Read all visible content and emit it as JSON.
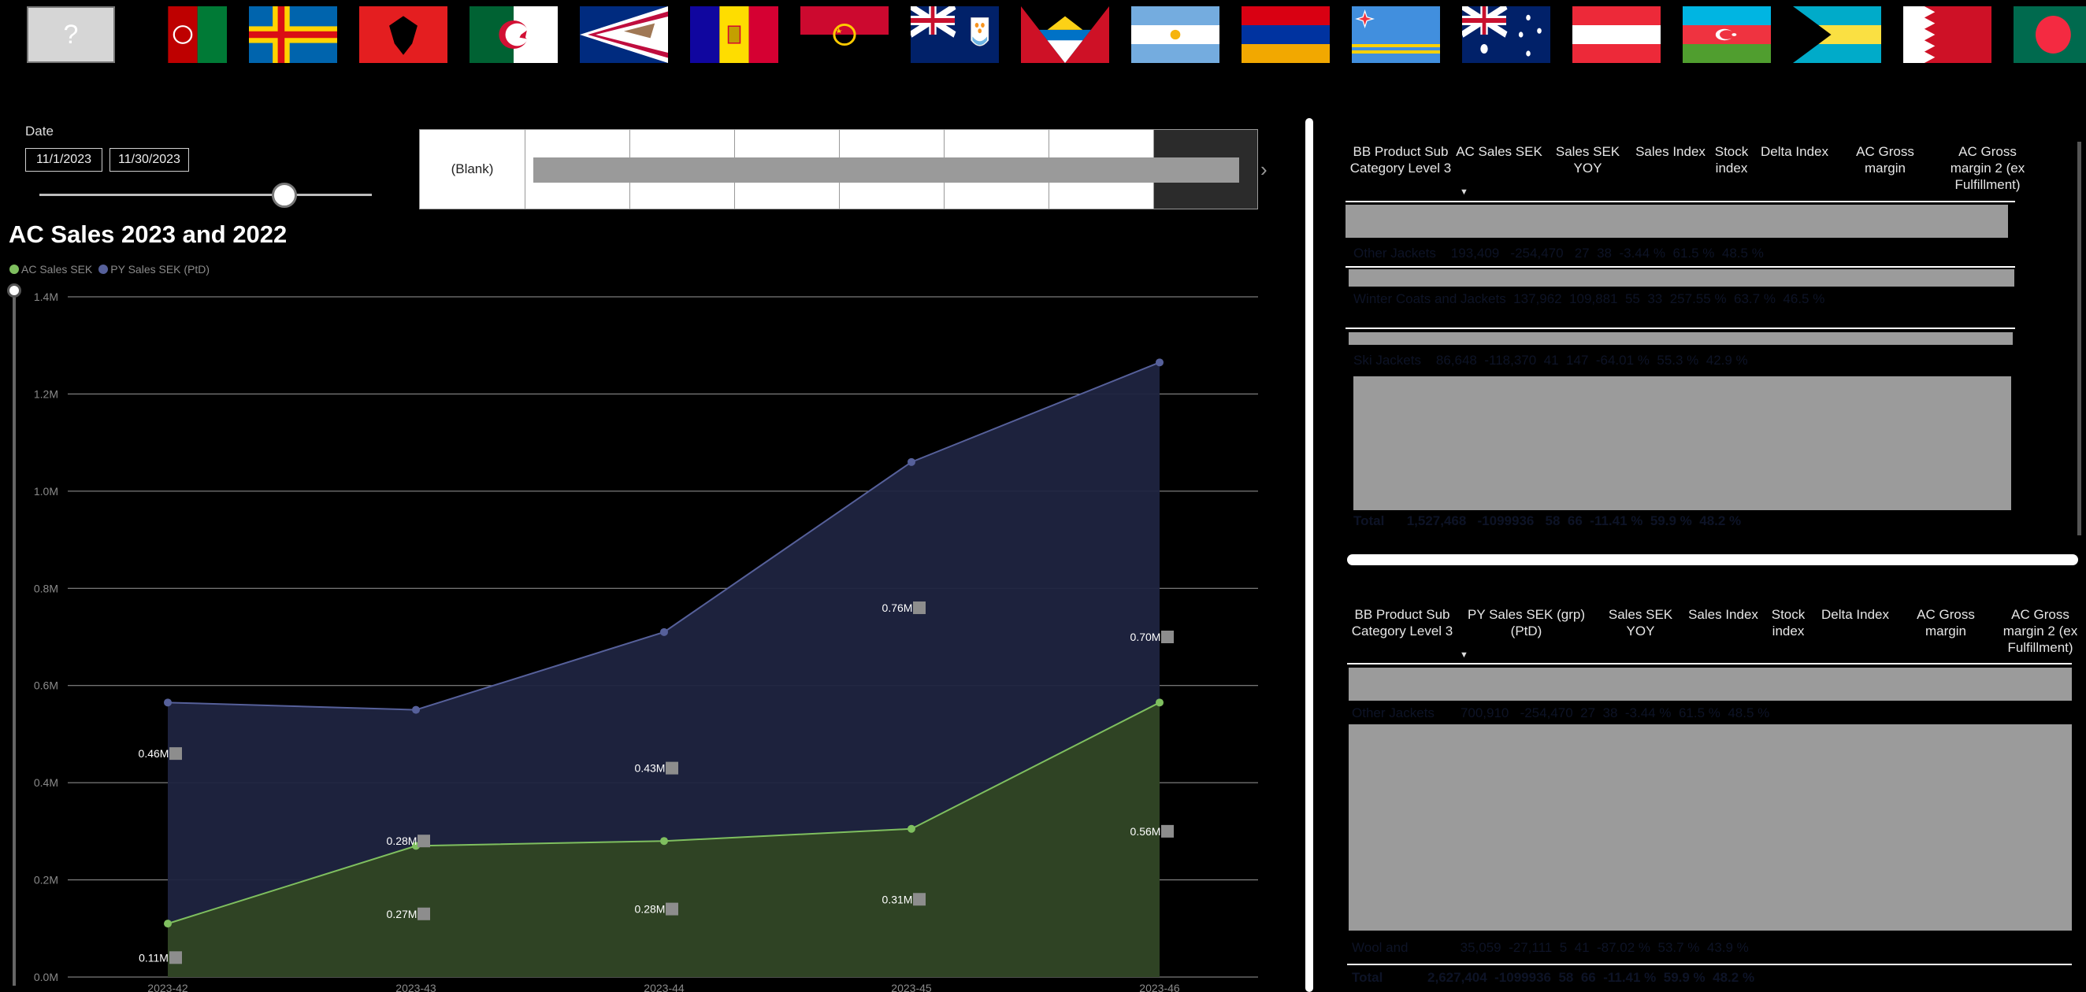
{
  "flags": [
    {
      "name": "unknown",
      "label": "?"
    },
    {
      "name": "afghanistan"
    },
    {
      "name": "aland"
    },
    {
      "name": "albania"
    },
    {
      "name": "algeria"
    },
    {
      "name": "american-samoa"
    },
    {
      "name": "andorra"
    },
    {
      "name": "angola"
    },
    {
      "name": "anguilla"
    },
    {
      "name": "antigua"
    },
    {
      "name": "argentina"
    },
    {
      "name": "armenia"
    },
    {
      "name": "aruba"
    },
    {
      "name": "australia"
    },
    {
      "name": "austria"
    },
    {
      "name": "azerbaijan"
    },
    {
      "name": "bahamas"
    },
    {
      "name": "bahrain"
    },
    {
      "name": "bangladesh"
    }
  ],
  "date_filter": {
    "label": "Date",
    "start": "11/1/2023",
    "end": "11/30/2023"
  },
  "tile_slicer": {
    "first_tile": "(Blank)",
    "next_icon": "chevron-right-icon"
  },
  "chart": {
    "title": "AC Sales 2023 and 2022",
    "legend": [
      {
        "name": "AC Sales SEK",
        "color": "#7fbf5f"
      },
      {
        "name": "PY Sales SEK (PtD)",
        "color": "#56609a"
      }
    ]
  },
  "chart_data": {
    "type": "area",
    "title": "AC Sales 2023 and 2022",
    "xlabel": "",
    "ylabel": "",
    "ylim": [
      0,
      1400000
    ],
    "y_ticks": [
      "0.0M",
      "0.2M",
      "0.4M",
      "0.6M",
      "0.8M",
      "1.0M",
      "1.2M",
      "1.4M"
    ],
    "categories": [
      "2023-42",
      "2023-43",
      "2023-44",
      "2023-45",
      "2023-46"
    ],
    "x_tick_labels": [
      "2023-42",
      "2023-43",
      "2023-44",
      "2023-45",
      "2023-46"
    ],
    "series": [
      {
        "name": "AC Sales SEK",
        "color": "#7fbf5f",
        "values": [
          110000,
          270000,
          280000,
          305000,
          565000
        ],
        "data_labels": [
          "0.11M",
          "0.27M",
          "0.28M",
          "0.31M",
          "0.56M"
        ]
      },
      {
        "name": "PY Sales SEK (PtD)",
        "color": "#56609a",
        "values": [
          565000,
          550000,
          710000,
          1060000,
          1265000
        ],
        "data_labels": [
          "0.46M",
          "0.28M",
          "0.43M",
          "0.76M",
          "0.70M"
        ]
      }
    ],
    "grid": true
  },
  "table1": {
    "headers": [
      "BB Product Sub Category Level 3",
      "AC Sales SEK",
      "Sales SEK YOY",
      "Sales Index",
      "Stock index",
      "Delta Index",
      "AC Gross margin",
      "AC Gross margin 2 (ex Fulfillment)"
    ],
    "visible_rows": [
      [
        "Other Jackets",
        "193,409",
        "-254,470",
        "27",
        "38",
        "-3.44 %",
        "61.5 %",
        "48.5 %"
      ],
      [
        "Winter Coats and Jackets",
        "137,962",
        "109,881",
        "55",
        "33",
        "257.55 %",
        "63.7 %",
        "46.5 %"
      ],
      [
        "Ski Jackets",
        "86,648",
        "-118,370",
        "41",
        "147",
        "-64.01 %",
        "55.3 %",
        "42.9 %"
      ]
    ],
    "total": [
      "Total",
      "1,527,468",
      "-1099936",
      "58",
      "66",
      "-11.41 %",
      "59.9 %",
      "48.2 %"
    ]
  },
  "table2": {
    "headers": [
      "BB Product Sub Category Level 3",
      "PY Sales SEK (grp) (PtD)",
      "Sales SEK YOY",
      "Sales Index",
      "Stock index",
      "Delta Index",
      "AC Gross margin",
      "AC Gross margin 2 (ex Fulfillment)"
    ],
    "visible_rows": [
      [
        "Other Jackets",
        "700,910",
        "-254,470",
        "27",
        "38",
        "-3.44 %",
        "61.5 %",
        "48.5 %"
      ],
      [
        "Wool and",
        "35,059",
        "-27,111",
        "5",
        "41",
        "-87.02 %",
        "53.7 %",
        "43.9 %"
      ]
    ],
    "total": [
      "Total",
      "2,627,404",
      "-1099936",
      "58",
      "66",
      "-11.41 %",
      "59.9 %",
      "48.2 %"
    ]
  }
}
